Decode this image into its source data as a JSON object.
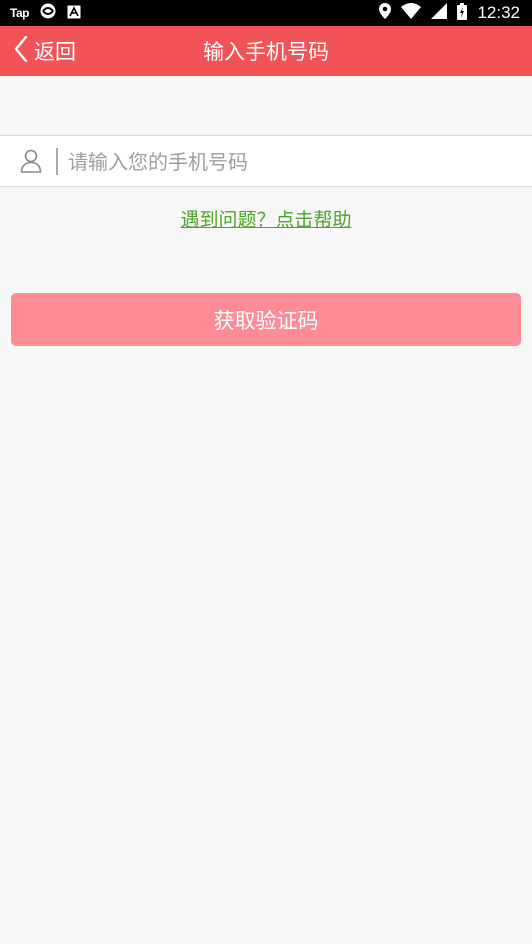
{
  "status_bar": {
    "app_label": "Tap",
    "time": "12:32",
    "icons": [
      "sync-icon",
      "a-badge-icon",
      "location-icon",
      "wifi-icon",
      "signal-icon",
      "battery-icon"
    ]
  },
  "app_bar": {
    "back_label": "返回",
    "title": "输入手机号码",
    "background": "#f25356"
  },
  "phone_field": {
    "placeholder": "请输入您的手机号码",
    "value": "",
    "icon": "user-icon"
  },
  "help_link": {
    "text": "遇到问题？点击帮助",
    "color": "#4ca52a"
  },
  "primary_button": {
    "label": "获取验证码",
    "color": "#ff8b96"
  }
}
